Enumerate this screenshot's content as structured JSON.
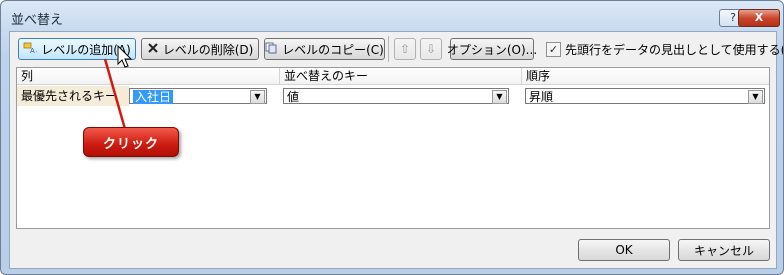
{
  "window": {
    "title": "並べ替え",
    "help_label": "?",
    "close_label": "X"
  },
  "toolbar": {
    "add_level": {
      "label": "レベルの追加(A)",
      "icon": "add-level-icon"
    },
    "delete_level": {
      "label": "レベルの削除(D)",
      "icon": "delete-x-icon"
    },
    "copy_level": {
      "label": "レベルのコピー(C)",
      "icon": "copy-icon"
    },
    "move_up": {
      "icon": "arrow-up-icon",
      "glyph": "⇧"
    },
    "move_down": {
      "icon": "arrow-down-icon",
      "glyph": "⇩"
    },
    "options": {
      "label": "オプション(O)..."
    },
    "header_checkbox": {
      "checked": true,
      "mark": "✓",
      "label": "先頭行をデータの見出しとして使用する(H)"
    }
  },
  "grid": {
    "headers": [
      "列",
      "並べ替えのキー",
      "順序"
    ],
    "rows": [
      {
        "row_label": "最優先されるキー",
        "column_value": "入社日",
        "sort_key_value": "値",
        "order_value": "昇順"
      }
    ]
  },
  "footer": {
    "ok_label": "OK",
    "cancel_label": "キャンセル"
  },
  "annotation": {
    "label": "クリック",
    "color": "#cc1b10"
  }
}
